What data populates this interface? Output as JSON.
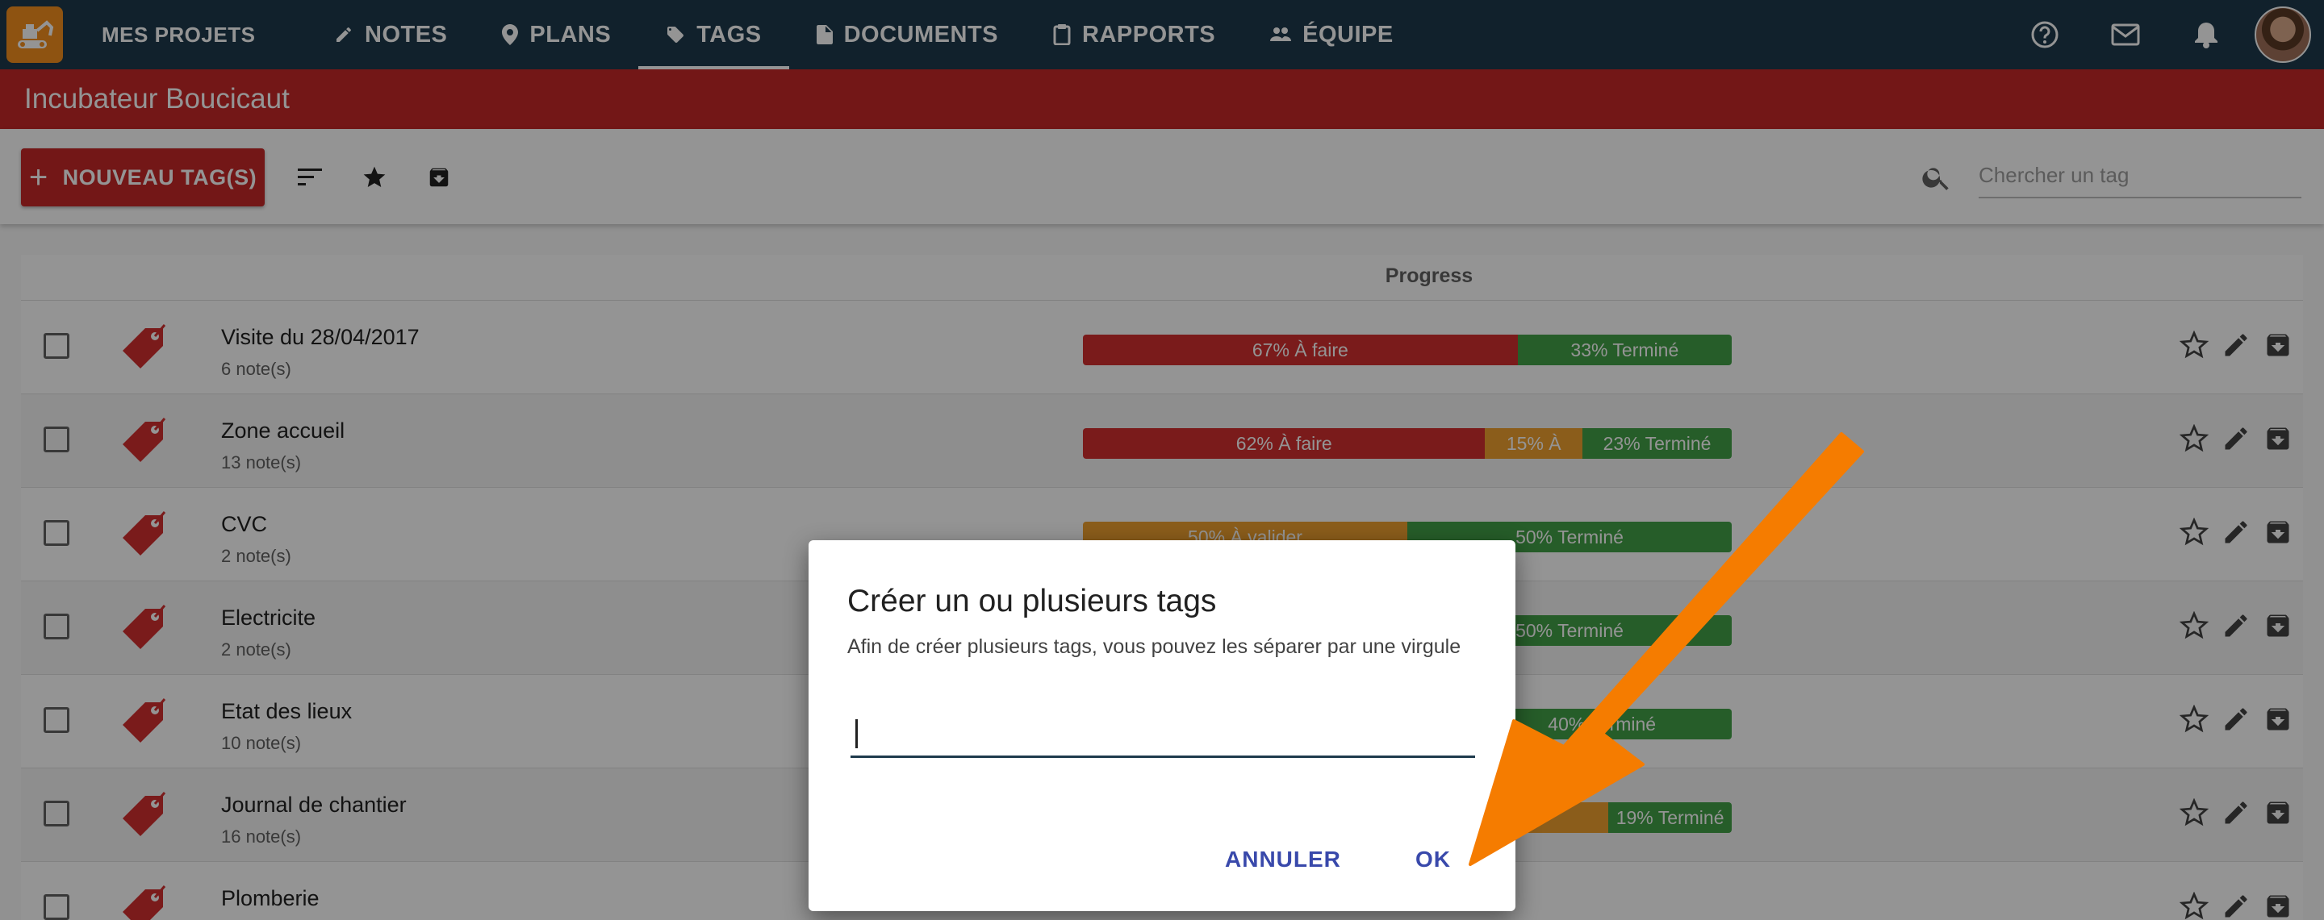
{
  "nav": {
    "brand": "MES PROJETS",
    "items": [
      {
        "label": "NOTES",
        "icon": "pencil-icon"
      },
      {
        "label": "PLANS",
        "icon": "location-pin-icon"
      },
      {
        "label": "TAGS",
        "icon": "tag-icon",
        "active": true
      },
      {
        "label": "DOCUMENTS",
        "icon": "document-icon"
      },
      {
        "label": "RAPPORTS",
        "icon": "clipboard-icon"
      },
      {
        "label": "ÉQUIPE",
        "icon": "people-icon"
      }
    ]
  },
  "project": {
    "title": "Incubateur Boucicaut"
  },
  "toolbar": {
    "new_label": "NOUVEAU TAG(S)",
    "search_placeholder": "Chercher un tag"
  },
  "table": {
    "progress_header": "Progress",
    "rows": [
      {
        "name": "Visite du 28/04/2017",
        "count": "6 note(s)",
        "segments": [
          {
            "type": "todo",
            "pct": 67,
            "label": "67% À faire"
          },
          {
            "type": "done",
            "pct": 33,
            "label": "33% Terminé"
          }
        ]
      },
      {
        "name": "Zone accueil",
        "count": "13 note(s)",
        "segments": [
          {
            "type": "todo",
            "pct": 62,
            "label": "62% À faire"
          },
          {
            "type": "validate",
            "pct": 15,
            "label": "15% À"
          },
          {
            "type": "done",
            "pct": 23,
            "label": "23% Terminé"
          }
        ]
      },
      {
        "name": "CVC",
        "count": "2 note(s)",
        "segments": [
          {
            "type": "validate",
            "pct": 50,
            "label": "50% À valider"
          },
          {
            "type": "done",
            "pct": 50,
            "label": "50% Terminé"
          }
        ]
      },
      {
        "name": "Electricite",
        "count": "2 note(s)",
        "segments": [
          {
            "type": "validate",
            "pct": 50,
            "label": ""
          },
          {
            "type": "done",
            "pct": 50,
            "label": "50% Terminé"
          }
        ]
      },
      {
        "name": "Etat des lieux",
        "count": "10 note(s)",
        "segments": [
          {
            "type": "todo",
            "pct": 60,
            "label": ""
          },
          {
            "type": "done",
            "pct": 40,
            "label": "40% Terminé"
          }
        ]
      },
      {
        "name": "Journal de chantier",
        "count": "16 note(s)",
        "segments": [
          {
            "type": "todo",
            "pct": 62,
            "label": ""
          },
          {
            "type": "validate",
            "pct": 19,
            "label": ""
          },
          {
            "type": "done",
            "pct": 19,
            "label": "19% Terminé"
          }
        ]
      },
      {
        "name": "Plomberie",
        "count": "",
        "segments": []
      }
    ]
  },
  "dialog": {
    "title": "Créer un ou plusieurs tags",
    "subtitle": "Afin de créer plusieurs tags, vous pouvez les séparer par une virgule",
    "input_value": "",
    "cancel_label": "ANNULER",
    "ok_label": "OK"
  },
  "colors": {
    "topbar": "#1e3a4c",
    "accent_red": "#c62828",
    "logo_orange": "#f5901e",
    "todo": "#d32f2f",
    "validate": "#f0a030",
    "done": "#43a047",
    "arrow": "#f57c00",
    "dialog_button": "#3949ab"
  }
}
